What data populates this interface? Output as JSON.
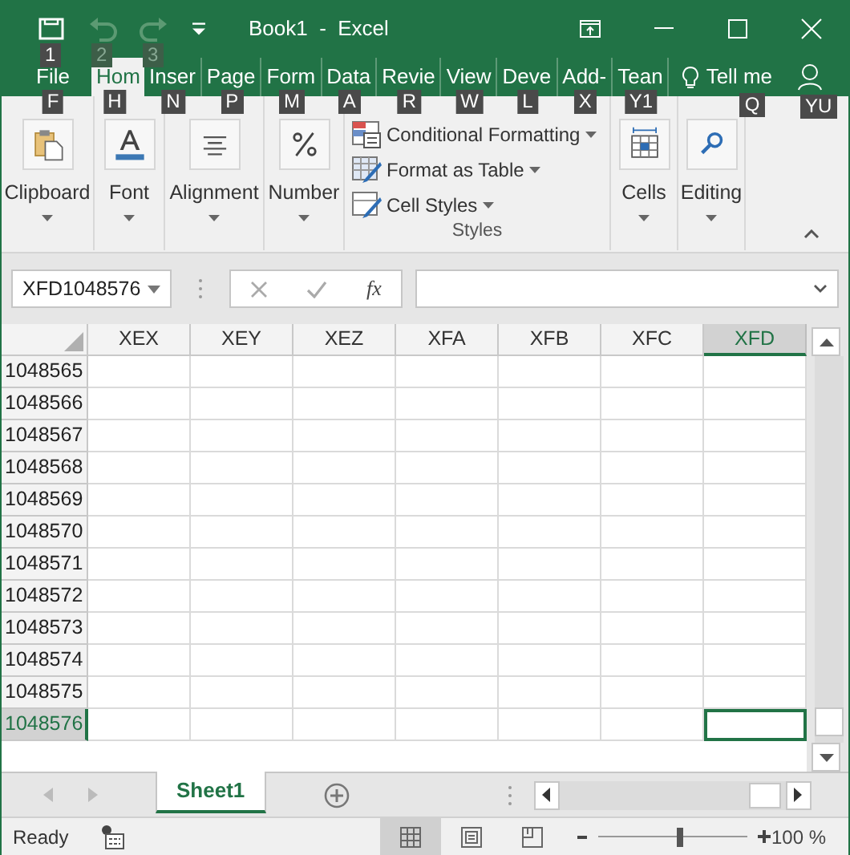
{
  "title_bar": {
    "title": "Book1  -  Excel"
  },
  "quick_access": [
    {
      "kind": "save",
      "keytip": "1",
      "disabled": false
    },
    {
      "kind": "undo",
      "keytip": "2",
      "disabled": true
    },
    {
      "kind": "redo",
      "keytip": "3",
      "disabled": true
    },
    {
      "kind": "customize"
    }
  ],
  "tabs": [
    {
      "label": "File",
      "keytip": "F",
      "selected": false
    },
    {
      "label": "Hom",
      "keytip": "H",
      "selected": true
    },
    {
      "label": "Inser",
      "keytip": "N",
      "selected": false
    },
    {
      "label": "Page",
      "keytip": "P",
      "selected": false
    },
    {
      "label": "Form",
      "keytip": "M",
      "selected": false
    },
    {
      "label": "Data",
      "keytip": "A",
      "selected": false
    },
    {
      "label": "Revie",
      "keytip": "R",
      "selected": false
    },
    {
      "label": "View",
      "keytip": "W",
      "selected": false
    },
    {
      "label": "Deve",
      "keytip": "L",
      "selected": false
    },
    {
      "label": "Add-",
      "keytip": "X",
      "selected": false
    },
    {
      "label": "Tean",
      "keytip": "Y1",
      "selected": false
    }
  ],
  "tell_me": {
    "label": "Tell me",
    "keytip": "Q"
  },
  "account": {
    "keytip": "YU"
  },
  "ribbon": {
    "groups": [
      {
        "kind": "clipboard",
        "label": "Clipboard"
      },
      {
        "kind": "font",
        "label": "Font"
      },
      {
        "kind": "alignment",
        "label": "Alignment"
      },
      {
        "kind": "number",
        "label": "Number"
      },
      {
        "kind": "styles",
        "label": "Styles",
        "buttons": [
          {
            "kind": "conditional",
            "label": "Conditional Formatting"
          },
          {
            "kind": "table",
            "label": "Format as Table"
          },
          {
            "kind": "cell_styles",
            "label": "Cell Styles"
          }
        ]
      },
      {
        "kind": "cells",
        "label": "Cells"
      },
      {
        "kind": "editing",
        "label": "Editing"
      }
    ]
  },
  "name_box": {
    "value": "XFD1048576"
  },
  "formula_bar": {
    "function_button": "fx"
  },
  "sheet": {
    "columns": [
      {
        "label": "XEX",
        "selected": false
      },
      {
        "label": "XEY",
        "selected": false
      },
      {
        "label": "XEZ",
        "selected": false
      },
      {
        "label": "XFA",
        "selected": false
      },
      {
        "label": "XFB",
        "selected": false
      },
      {
        "label": "XFC",
        "selected": false
      },
      {
        "label": "XFD",
        "selected": true
      }
    ],
    "rows": [
      {
        "label": "1048565",
        "selected": false
      },
      {
        "label": "1048566",
        "selected": false
      },
      {
        "label": "1048567",
        "selected": false
      },
      {
        "label": "1048568",
        "selected": false
      },
      {
        "label": "1048569",
        "selected": false
      },
      {
        "label": "1048570",
        "selected": false
      },
      {
        "label": "1048571",
        "selected": false
      },
      {
        "label": "1048572",
        "selected": false
      },
      {
        "label": "1048573",
        "selected": false
      },
      {
        "label": "1048574",
        "selected": false
      },
      {
        "label": "1048575",
        "selected": false
      },
      {
        "label": "1048576",
        "selected": true
      }
    ]
  },
  "sheet_tabs": [
    {
      "label": "Sheet1",
      "selected": true
    }
  ],
  "status_bar": {
    "status": "Ready",
    "views": [
      {
        "kind": "normal",
        "selected": true
      },
      {
        "kind": "page_layout",
        "selected": false
      },
      {
        "kind": "page_break",
        "selected": false
      }
    ],
    "zoom": {
      "level": 0.55,
      "reading": "100 %"
    }
  }
}
